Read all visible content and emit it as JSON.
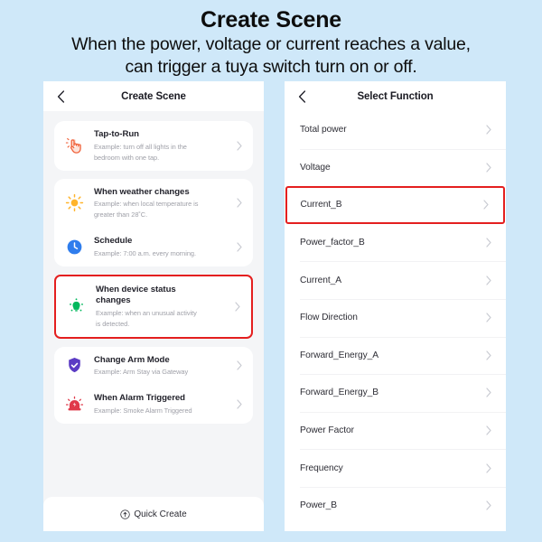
{
  "header": {
    "title": "Create Scene",
    "subtitle_line1": "When the power, voltage or current reaches a value,",
    "subtitle_line2": "can trigger a tuya switch turn on or off."
  },
  "colors": {
    "page_background": "#cfe8f9",
    "highlight_border": "#e41f1f",
    "panel_background": "#f4f5f7",
    "card_background": "#ffffff"
  },
  "left_panel": {
    "nav": {
      "back_icon": "chevron-left-icon",
      "title": "Create Scene"
    },
    "scenes": [
      {
        "title": "Tap-to-Run",
        "desc_line1": "Example: turn off all lights in the",
        "desc_line2": "bedroom with one tap.",
        "icon": "tap-hand-icon",
        "icon_color": "#f0633c",
        "highlighted": false
      },
      {
        "title": "When weather changes",
        "desc_line1": "Example: when local temperature is",
        "desc_line2": "greater than 28˚C.",
        "icon": "sun-icon",
        "icon_color": "#ffb42b",
        "highlighted": false
      },
      {
        "title": "Schedule",
        "desc_line1": "Example: 7:00 a.m. every morning.",
        "desc_line2": "",
        "icon": "clock-icon",
        "icon_color": "#2f7ded",
        "highlighted": false
      },
      {
        "title_line1": "When device status",
        "title_line2": "changes",
        "title": "When device status changes",
        "desc_line1": "Example: when an unusual activity",
        "desc_line2": "is detected.",
        "icon": "motion-sensor-icon",
        "icon_color": "#00b85c",
        "highlighted": true
      },
      {
        "title": "Change Arm Mode",
        "desc_line1": "Example: Arm Stay via Gateway",
        "desc_line2": "",
        "icon": "shield-check-icon",
        "icon_color": "#5b3bc4",
        "highlighted": false
      },
      {
        "title": "When Alarm Triggered",
        "desc_line1": "Example: Smoke Alarm Triggered",
        "desc_line2": "",
        "icon": "alarm-siren-icon",
        "icon_color": "#e03a4a",
        "highlighted": false
      }
    ],
    "quick_create": {
      "label": "Quick Create",
      "icon": "circle-arrow-up-icon"
    }
  },
  "right_panel": {
    "nav": {
      "back_icon": "chevron-left-icon",
      "title": "Select Function"
    },
    "functions": [
      {
        "label": "Total power",
        "highlighted": false
      },
      {
        "label": "Voltage",
        "highlighted": false
      },
      {
        "label": "Current_B",
        "highlighted": true
      },
      {
        "label": "Power_factor_B",
        "highlighted": false
      },
      {
        "label": "Current_A",
        "highlighted": false
      },
      {
        "label": "Flow Direction",
        "highlighted": false
      },
      {
        "label": "Forward_Energy_A",
        "highlighted": false
      },
      {
        "label": "Forward_Energy_B",
        "highlighted": false
      },
      {
        "label": "Power Factor",
        "highlighted": false
      },
      {
        "label": "Frequency",
        "highlighted": false
      },
      {
        "label": "Power_B",
        "highlighted": false
      }
    ]
  }
}
